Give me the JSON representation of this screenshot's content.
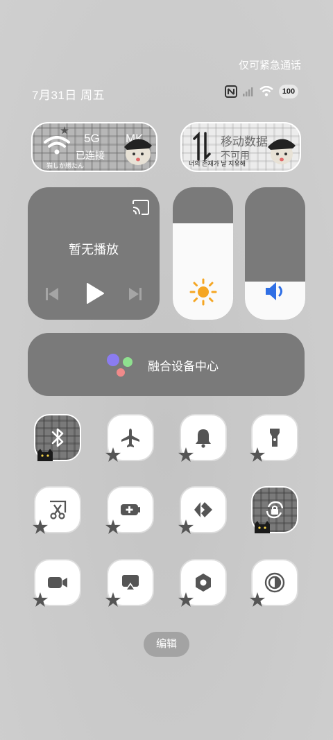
{
  "status": {
    "emergency_text": "仅可紧急通话",
    "date": "7月31日 周五",
    "battery": "100"
  },
  "connections": {
    "wifi": {
      "band": "5G",
      "name_partial": "MK",
      "status": "已连接",
      "caption": "猫しか勝たん"
    },
    "mobile": {
      "title": "移动数据",
      "status": "不可用",
      "caption": "너의 존재가 날 지유해"
    }
  },
  "media": {
    "title": "暂无播放"
  },
  "sliders": {
    "brightness_level": 0.73,
    "volume_level": 0.29
  },
  "hub": {
    "label": "融合设备中心",
    "dot_colors": [
      "#8b7cf0",
      "#8fe08f",
      "#f08a8a"
    ]
  },
  "tiles": [
    {
      "name": "bluetooth",
      "icon": "bluetooth-icon",
      "active": true
    },
    {
      "name": "airplane-mode",
      "icon": "airplane-icon",
      "active": false
    },
    {
      "name": "ring-mode",
      "icon": "bell-icon",
      "active": false
    },
    {
      "name": "flashlight",
      "icon": "flashlight-icon",
      "active": false
    },
    {
      "name": "screenshot",
      "icon": "scissors-icon",
      "active": false
    },
    {
      "name": "battery-saver",
      "icon": "battery-plus-icon",
      "active": false
    },
    {
      "name": "remote-control",
      "icon": "code-arrows-icon",
      "active": false
    },
    {
      "name": "rotation-lock",
      "icon": "rotation-lock-icon",
      "active": true
    },
    {
      "name": "screen-record",
      "icon": "video-camera-icon",
      "active": false
    },
    {
      "name": "cast-screen",
      "icon": "airplay-icon",
      "active": false
    },
    {
      "name": "settings",
      "icon": "hexagon-nut-icon",
      "active": false
    },
    {
      "name": "dark-mode",
      "icon": "contrast-icon",
      "active": false
    }
  ],
  "edit": {
    "label": "编辑"
  }
}
